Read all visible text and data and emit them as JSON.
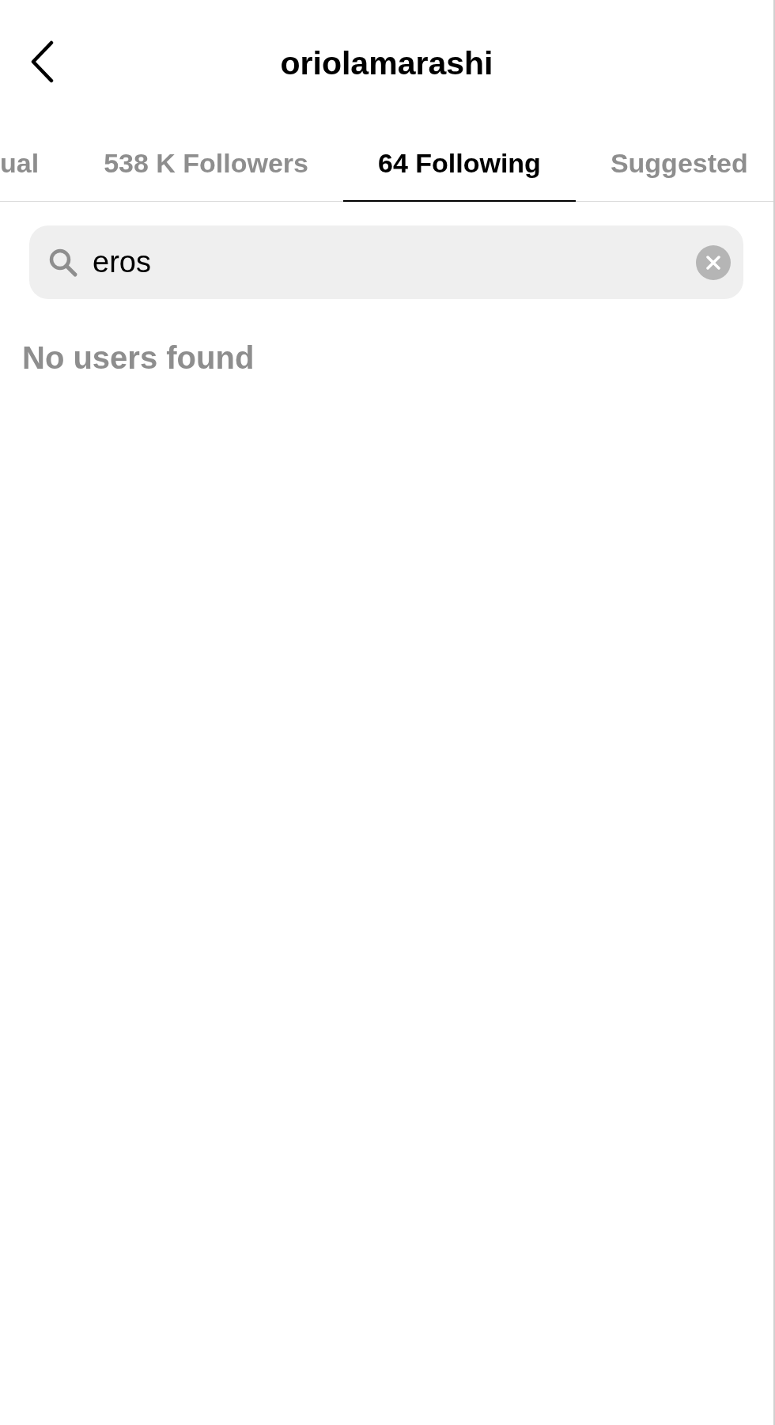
{
  "header": {
    "title": "oriolamarashi"
  },
  "tabs": [
    {
      "label": "ual",
      "selected": false
    },
    {
      "label": "538 K Followers",
      "selected": false
    },
    {
      "label": "64 Following",
      "selected": true
    },
    {
      "label": "Suggested",
      "selected": false
    }
  ],
  "search": {
    "value": "eros"
  },
  "empty_message": "No users found"
}
